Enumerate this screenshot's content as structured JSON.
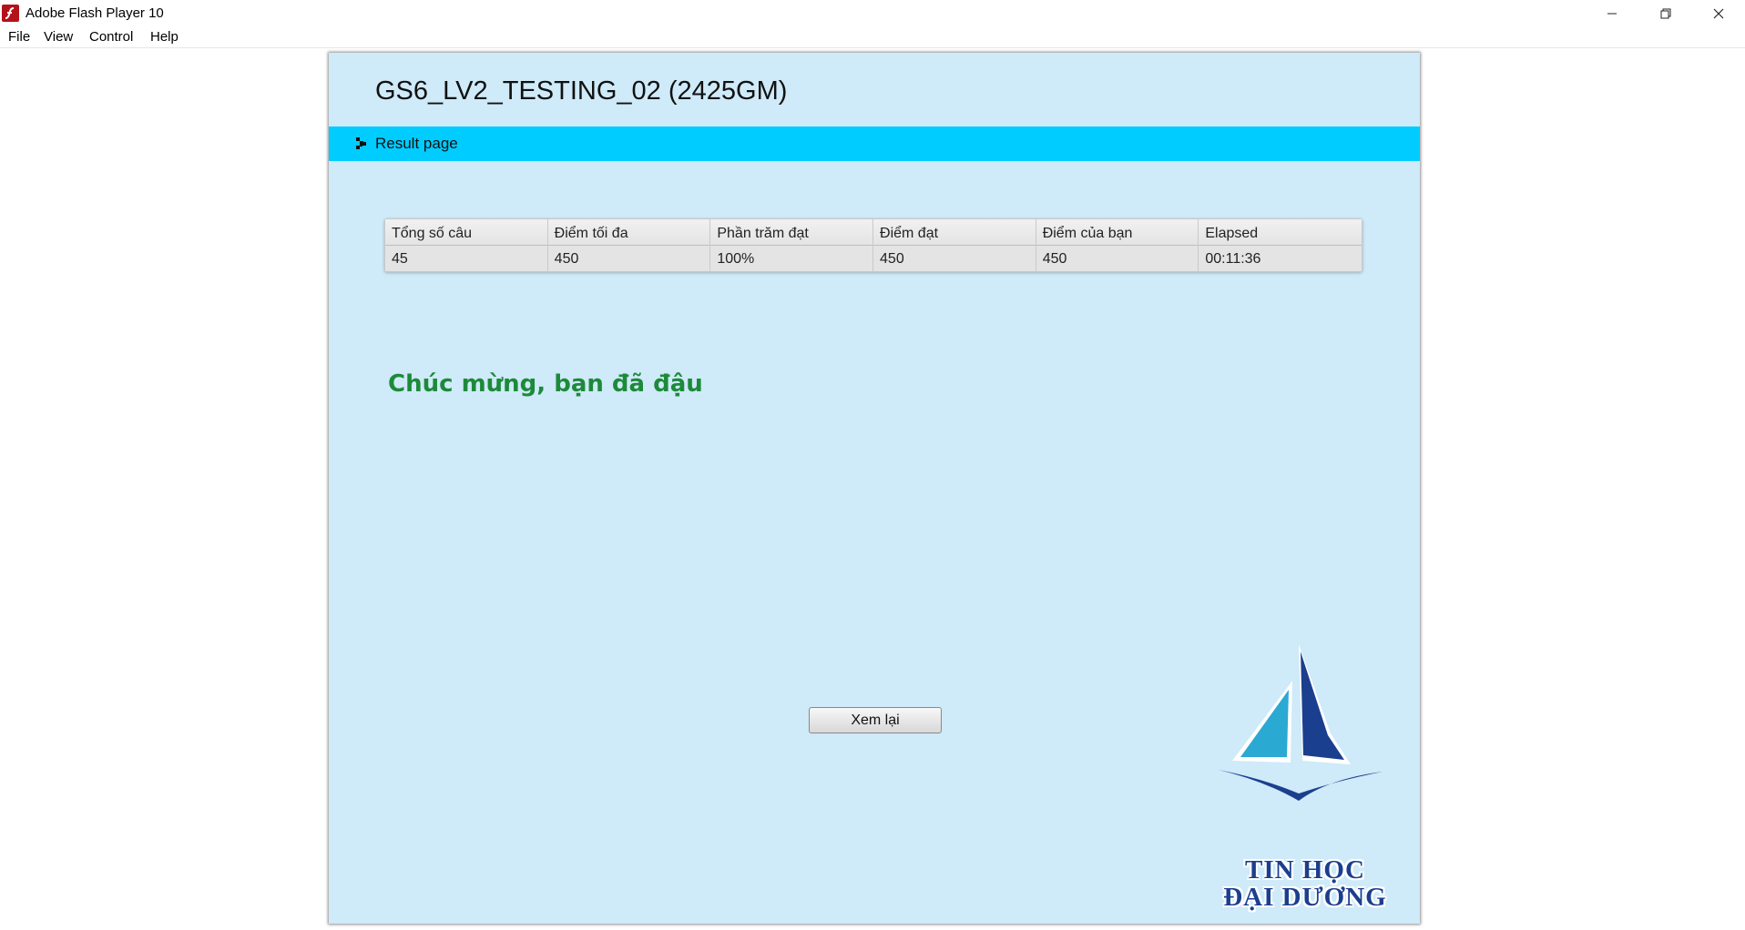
{
  "window": {
    "title": "Adobe Flash Player 10"
  },
  "menu": {
    "file": "File",
    "view": "View",
    "control": "Control",
    "help": "Help"
  },
  "exam": {
    "title": "GS6_LV2_TESTING_02 (2425GM)",
    "section_label": "Result page"
  },
  "results": {
    "columns": [
      {
        "header": "Tổng số câu",
        "value": "45"
      },
      {
        "header": "Điểm tối đa",
        "value": "450"
      },
      {
        "header": "Phần trăm đạt",
        "value": "100%"
      },
      {
        "header": "Điểm đạt",
        "value": "450"
      },
      {
        "header": "Điểm của bạn",
        "value": "450"
      },
      {
        "header": "Elapsed",
        "value": "00:11:36"
      }
    ]
  },
  "message": "Chúc mừng, bạn đã đậu",
  "review_button": "Xem lại",
  "logo": {
    "line1": "TIN HỌC",
    "line2": "ĐẠI DƯƠNG"
  },
  "colors": {
    "stage_bg": "#cfeaf8",
    "section_bar": "#00ccff",
    "message": "#1d8a3a",
    "logo_blue": "#1b3f8f",
    "logo_cyan": "#2aa9d2"
  }
}
